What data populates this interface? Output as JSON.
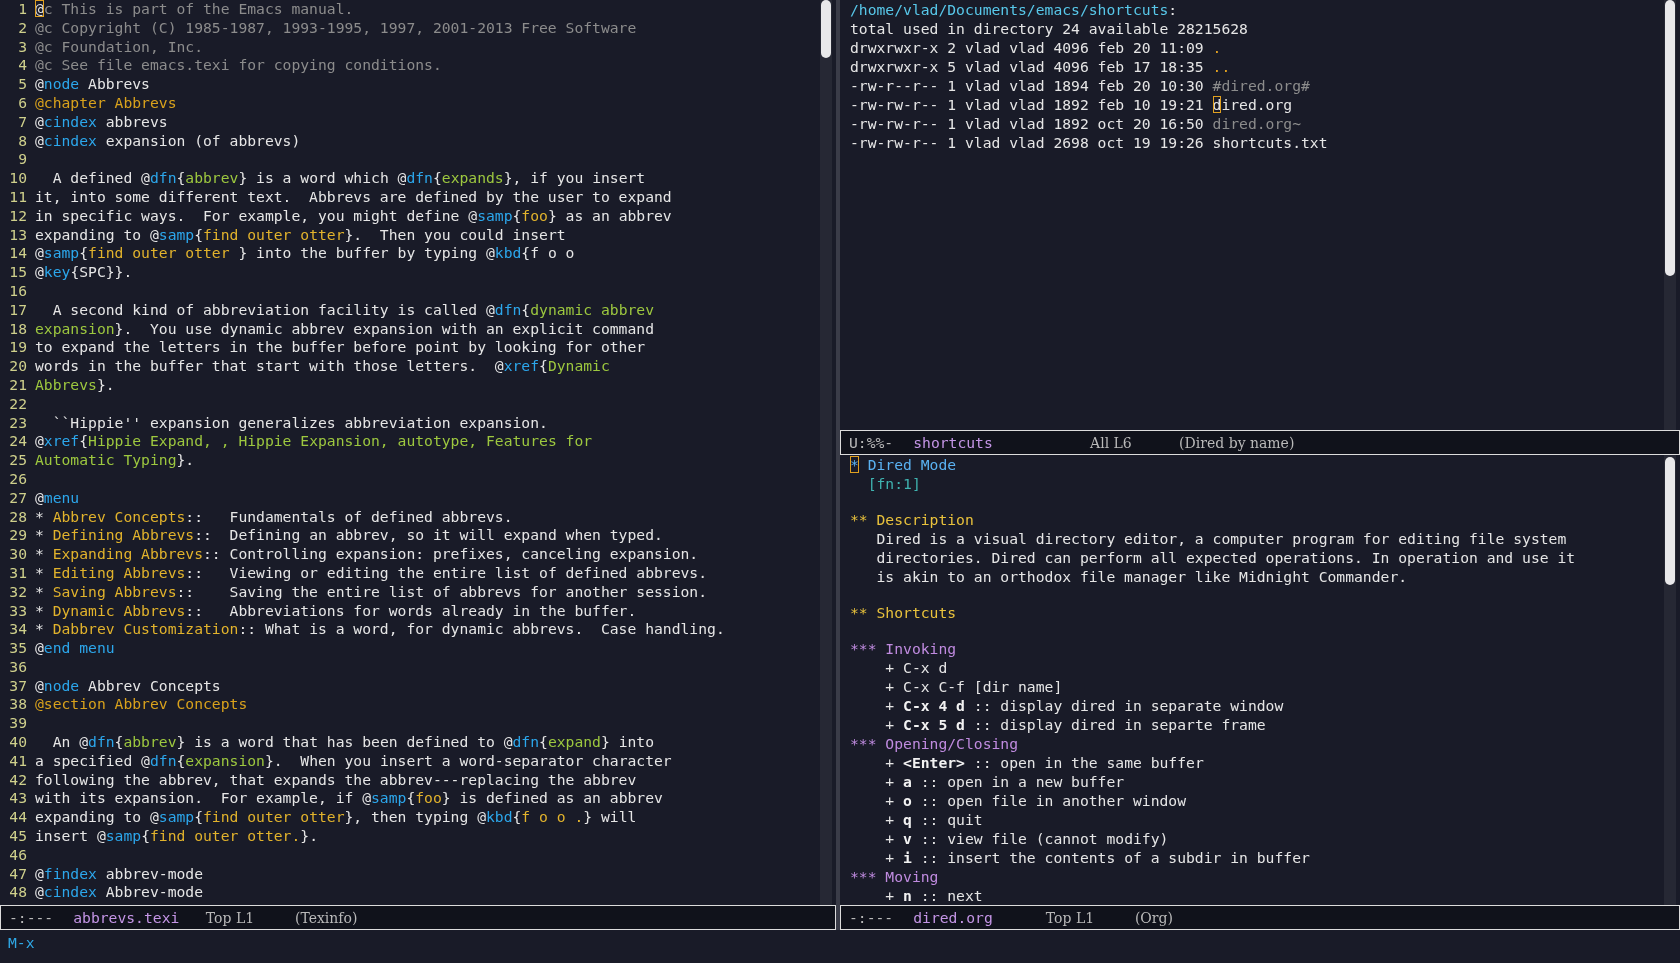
{
  "left_window": {
    "lines": [
      {
        "number": "1",
        "segments": [
          {
            "kind": "cursor",
            "text": "@"
          },
          {
            "kind": "comment",
            "text": "c This is part of the Emacs manual."
          }
        ]
      },
      {
        "number": "2",
        "segments": [
          {
            "kind": "comment",
            "text": "@c Copyright (C) 1985-1987, 1993-1995, 1997, 2001-2013 Free Software"
          }
        ]
      },
      {
        "number": "3",
        "segments": [
          {
            "kind": "comment",
            "text": "@c Foundation, Inc."
          }
        ]
      },
      {
        "number": "4",
        "segments": [
          {
            "kind": "comment",
            "text": "@c See file emacs.texi for copying conditions."
          }
        ]
      },
      {
        "number": "5",
        "segments": [
          {
            "kind": "plain",
            "text": "@"
          },
          {
            "kind": "command",
            "text": "node"
          },
          {
            "kind": "plain",
            "text": " Abbrevs"
          }
        ]
      },
      {
        "number": "6",
        "segments": [
          {
            "kind": "heading",
            "text": "@chapter Abbrevs"
          }
        ]
      },
      {
        "number": "7",
        "segments": [
          {
            "kind": "plain",
            "text": "@"
          },
          {
            "kind": "command",
            "text": "cindex"
          },
          {
            "kind": "plain",
            "text": " abbrevs"
          }
        ]
      },
      {
        "number": "8",
        "segments": [
          {
            "kind": "plain",
            "text": "@"
          },
          {
            "kind": "command",
            "text": "cindex"
          },
          {
            "kind": "plain",
            "text": " expansion (of abbrevs)"
          }
        ]
      },
      {
        "number": "9"
      },
      {
        "number": "10",
        "segments": [
          {
            "kind": "plain",
            "text": "  A defined @"
          },
          {
            "kind": "command",
            "text": "dfn"
          },
          {
            "kind": "plain",
            "text": "{"
          },
          {
            "kind": "argument",
            "text": "abbrev"
          },
          {
            "kind": "plain",
            "text": "} is a word which @"
          },
          {
            "kind": "command",
            "text": "dfn"
          },
          {
            "kind": "plain",
            "text": "{"
          },
          {
            "kind": "argument",
            "text": "expands"
          },
          {
            "kind": "plain",
            "text": "}, if you insert"
          }
        ]
      },
      {
        "number": "11",
        "segments": [
          {
            "kind": "plain",
            "text": "it, into some different text.  Abbrevs are defined by the user to expand"
          }
        ]
      },
      {
        "number": "12",
        "segments": [
          {
            "kind": "plain",
            "text": "in specific ways.  For example, you might define @"
          },
          {
            "kind": "command",
            "text": "samp"
          },
          {
            "kind": "plain",
            "text": "{"
          },
          {
            "kind": "string",
            "text": "foo"
          },
          {
            "kind": "plain",
            "text": "} as an abbrev"
          }
        ]
      },
      {
        "number": "13",
        "segments": [
          {
            "kind": "plain",
            "text": "expanding to @"
          },
          {
            "kind": "command",
            "text": "samp"
          },
          {
            "kind": "plain",
            "text": "{"
          },
          {
            "kind": "string",
            "text": "find outer otter"
          },
          {
            "kind": "plain",
            "text": "}.  Then you could insert"
          }
        ]
      },
      {
        "number": "14",
        "segments": [
          {
            "kind": "plain",
            "text": "@"
          },
          {
            "kind": "command",
            "text": "samp"
          },
          {
            "kind": "plain",
            "text": "{"
          },
          {
            "kind": "string",
            "text": "find outer otter "
          },
          {
            "kind": "plain",
            "text": "} into the buffer by typing @"
          },
          {
            "kind": "command",
            "text": "kbd"
          },
          {
            "kind": "plain",
            "text": "{f o o"
          }
        ]
      },
      {
        "number": "15",
        "segments": [
          {
            "kind": "plain",
            "text": "@"
          },
          {
            "kind": "command",
            "text": "key"
          },
          {
            "kind": "plain",
            "text": "{SPC}}."
          }
        ]
      },
      {
        "number": "16"
      },
      {
        "number": "17",
        "segments": [
          {
            "kind": "plain",
            "text": "  A second kind of abbreviation facility is called @"
          },
          {
            "kind": "command",
            "text": "dfn"
          },
          {
            "kind": "plain",
            "text": "{"
          },
          {
            "kind": "argument",
            "text": "dynamic abbrev"
          }
        ]
      },
      {
        "number": "18",
        "segments": [
          {
            "kind": "argument",
            "text": "expansion"
          },
          {
            "kind": "plain",
            "text": "}.  You use dynamic abbrev expansion with an explicit command"
          }
        ]
      },
      {
        "number": "19",
        "segments": [
          {
            "kind": "plain",
            "text": "to expand the letters in the buffer before point by looking for other"
          }
        ]
      },
      {
        "number": "20",
        "segments": [
          {
            "kind": "plain",
            "text": "words in the buffer that start with those letters.  @"
          },
          {
            "kind": "command",
            "text": "xref"
          },
          {
            "kind": "plain",
            "text": "{"
          },
          {
            "kind": "argument",
            "text": "Dynamic"
          }
        ]
      },
      {
        "number": "21",
        "segments": [
          {
            "kind": "argument",
            "text": "Abbrevs"
          },
          {
            "kind": "plain",
            "text": "}."
          }
        ]
      },
      {
        "number": "22"
      },
      {
        "number": "23",
        "segments": [
          {
            "kind": "plain",
            "text": "  ``Hippie'' expansion generalizes abbreviation expansion."
          }
        ]
      },
      {
        "number": "24",
        "segments": [
          {
            "kind": "plain",
            "text": "@"
          },
          {
            "kind": "command",
            "text": "xref"
          },
          {
            "kind": "plain",
            "text": "{"
          },
          {
            "kind": "argument",
            "text": "Hippie Expand, , Hippie Expansion, autotype, Features for"
          }
        ]
      },
      {
        "number": "25",
        "segments": [
          {
            "kind": "argument",
            "text": "Automatic Typing"
          },
          {
            "kind": "plain",
            "text": "}."
          }
        ]
      },
      {
        "number": "26"
      },
      {
        "number": "27",
        "segments": [
          {
            "kind": "plain",
            "text": "@"
          },
          {
            "kind": "command",
            "text": "menu"
          }
        ]
      },
      {
        "number": "28",
        "segments": [
          {
            "kind": "plain",
            "text": "* "
          },
          {
            "kind": "string",
            "text": "Abbrev Concepts"
          },
          {
            "kind": "plain",
            "text": "::   Fundamentals of defined abbrevs."
          }
        ]
      },
      {
        "number": "29",
        "segments": [
          {
            "kind": "plain",
            "text": "* "
          },
          {
            "kind": "string",
            "text": "Defining Abbrevs"
          },
          {
            "kind": "plain",
            "text": "::  Defining an abbrev, so it will expand when typed."
          }
        ]
      },
      {
        "number": "30",
        "segments": [
          {
            "kind": "plain",
            "text": "* "
          },
          {
            "kind": "string",
            "text": "Expanding Abbrevs"
          },
          {
            "kind": "plain",
            "text": ":: Controlling expansion: prefixes, canceling expansion."
          }
        ]
      },
      {
        "number": "31",
        "segments": [
          {
            "kind": "plain",
            "text": "* "
          },
          {
            "kind": "string",
            "text": "Editing Abbrevs"
          },
          {
            "kind": "plain",
            "text": "::   Viewing or editing the entire list of defined abbrevs."
          }
        ]
      },
      {
        "number": "32",
        "segments": [
          {
            "kind": "plain",
            "text": "* "
          },
          {
            "kind": "string",
            "text": "Saving Abbrevs"
          },
          {
            "kind": "plain",
            "text": "::    Saving the entire list of abbrevs for another session."
          }
        ]
      },
      {
        "number": "33",
        "segments": [
          {
            "kind": "plain",
            "text": "* "
          },
          {
            "kind": "string",
            "text": "Dynamic Abbrevs"
          },
          {
            "kind": "plain",
            "text": "::   Abbreviations for words already in the buffer."
          }
        ]
      },
      {
        "number": "34",
        "segments": [
          {
            "kind": "plain",
            "text": "* "
          },
          {
            "kind": "string",
            "text": "Dabbrev Customization"
          },
          {
            "kind": "plain",
            "text": ":: What is a word, for dynamic abbrevs.  Case handling."
          }
        ]
      },
      {
        "number": "35",
        "segments": [
          {
            "kind": "plain",
            "text": "@"
          },
          {
            "kind": "command",
            "text": "end menu"
          }
        ]
      },
      {
        "number": "36"
      },
      {
        "number": "37",
        "segments": [
          {
            "kind": "plain",
            "text": "@"
          },
          {
            "kind": "command",
            "text": "node"
          },
          {
            "kind": "plain",
            "text": " Abbrev Concepts"
          }
        ]
      },
      {
        "number": "38",
        "segments": [
          {
            "kind": "heading",
            "text": "@section Abbrev Concepts"
          }
        ]
      },
      {
        "number": "39"
      },
      {
        "number": "40",
        "segments": [
          {
            "kind": "plain",
            "text": "  An @"
          },
          {
            "kind": "command",
            "text": "dfn"
          },
          {
            "kind": "plain",
            "text": "{"
          },
          {
            "kind": "argument",
            "text": "abbrev"
          },
          {
            "kind": "plain",
            "text": "} is a word that has been defined to @"
          },
          {
            "kind": "command",
            "text": "dfn"
          },
          {
            "kind": "plain",
            "text": "{"
          },
          {
            "kind": "argument",
            "text": "expand"
          },
          {
            "kind": "plain",
            "text": "} into"
          }
        ]
      },
      {
        "number": "41",
        "segments": [
          {
            "kind": "plain",
            "text": "a specified @"
          },
          {
            "kind": "command",
            "text": "dfn"
          },
          {
            "kind": "plain",
            "text": "{"
          },
          {
            "kind": "argument",
            "text": "expansion"
          },
          {
            "kind": "plain",
            "text": "}.  When you insert a word-separator character"
          }
        ]
      },
      {
        "number": "42",
        "segments": [
          {
            "kind": "plain",
            "text": "following the abbrev, that expands the abbrev---replacing the abbrev"
          }
        ]
      },
      {
        "number": "43",
        "segments": [
          {
            "kind": "plain",
            "text": "with its expansion.  For example, if @"
          },
          {
            "kind": "command",
            "text": "samp"
          },
          {
            "kind": "plain",
            "text": "{"
          },
          {
            "kind": "string",
            "text": "foo"
          },
          {
            "kind": "plain",
            "text": "} is defined as an abbrev"
          }
        ]
      },
      {
        "number": "44",
        "segments": [
          {
            "kind": "plain",
            "text": "expanding to @"
          },
          {
            "kind": "command",
            "text": "samp"
          },
          {
            "kind": "plain",
            "text": "{"
          },
          {
            "kind": "string",
            "text": "find outer otter"
          },
          {
            "kind": "plain",
            "text": "}, then typing @"
          },
          {
            "kind": "command",
            "text": "kbd"
          },
          {
            "kind": "plain",
            "text": "{"
          },
          {
            "kind": "string",
            "text": "f o o ."
          },
          {
            "kind": "plain",
            "text": "} will"
          }
        ]
      },
      {
        "number": "45",
        "segments": [
          {
            "kind": "plain",
            "text": "insert @"
          },
          {
            "kind": "command",
            "text": "samp"
          },
          {
            "kind": "plain",
            "text": "{"
          },
          {
            "kind": "string",
            "text": "find outer otter."
          },
          {
            "kind": "plain",
            "text": "}."
          }
        ]
      },
      {
        "number": "46"
      },
      {
        "number": "47",
        "segments": [
          {
            "kind": "plain",
            "text": "@"
          },
          {
            "kind": "command",
            "text": "findex"
          },
          {
            "kind": "plain",
            "text": " abbrev-mode"
          }
        ]
      },
      {
        "number": "48",
        "segments": [
          {
            "kind": "plain",
            "text": "@"
          },
          {
            "kind": "command",
            "text": "cindex"
          },
          {
            "kind": "plain",
            "text": " Abbrev-mode"
          }
        ]
      }
    ],
    "mode_line": {
      "status": "-:---",
      "buffer": "abbrevs.texi",
      "position": "Top L1",
      "mode": "(Texinfo)"
    }
  },
  "dired_window": {
    "lines": [
      {
        "kind": "text",
        "segments": [
          {
            "kind": "path",
            "text": "/home/vlad/Documents/emacs/shortcuts"
          },
          {
            "kind": "plain",
            "text": ":"
          }
        ]
      },
      {
        "kind": "text",
        "segments": [
          {
            "kind": "plain",
            "text": "total used in directory 24 available 28215628"
          }
        ]
      },
      {
        "kind": "text",
        "segments": [
          {
            "kind": "plain",
            "text": "drwxrwxr-x 2 vlad vlad 4096 feb 20 11:09 "
          },
          {
            "kind": "directory",
            "text": "."
          }
        ]
      },
      {
        "kind": "text",
        "segments": [
          {
            "kind": "plain",
            "text": "drwxrwxr-x 5 vlad vlad 4096 feb 17 18:35 "
          },
          {
            "kind": "directory",
            "text": ".."
          }
        ]
      },
      {
        "kind": "text",
        "segments": [
          {
            "kind": "plain",
            "text": "-rw-r--r-- 1 vlad vlad 1894 feb 20 10:30 "
          },
          {
            "kind": "backup",
            "text": "#dired.org#"
          }
        ]
      },
      {
        "kind": "text",
        "segments": [
          {
            "kind": "plain",
            "text": "-rw-rw-r-- 1 vlad vlad 1892 feb 10 19:21 "
          },
          {
            "kind": "cursor",
            "text": "d"
          },
          {
            "kind": "plain",
            "text": "ired.org"
          }
        ]
      },
      {
        "kind": "text",
        "segments": [
          {
            "kind": "plain",
            "text": "-rw-rw-r-- 1 vlad vlad 1892 oct 20 16:50 "
          },
          {
            "kind": "backup",
            "text": "dired.org~"
          }
        ]
      },
      {
        "kind": "text",
        "segments": [
          {
            "kind": "plain",
            "text": "-rw-rw-r-- 1 vlad vlad 2698 oct 19 19:26 shortcuts.txt"
          }
        ]
      }
    ],
    "mode_line": {
      "status": "U:%%-",
      "buffer": "shortcuts",
      "position": "All L6",
      "mode": "(Dired by name)"
    }
  },
  "org_window": {
    "lines": [
      {
        "kind": "text",
        "segments": [
          {
            "kind": "hollow_cursor",
            "text": "*"
          },
          {
            "kind": "title",
            "text": " Dired Mode"
          }
        ]
      },
      {
        "kind": "text",
        "segments": [
          {
            "kind": "footnote",
            "text": "  [fn:1]"
          }
        ]
      },
      {
        "kind": "blank"
      },
      {
        "kind": "text",
        "segments": [
          {
            "kind": "section",
            "text": "** Description"
          }
        ]
      },
      {
        "kind": "text",
        "segments": [
          {
            "kind": "plain",
            "text": "   Dired is a visual directory editor, a computer program for editing file system"
          }
        ]
      },
      {
        "kind": "text",
        "segments": [
          {
            "kind": "plain",
            "text": "   directories. Dired can perform all expected operations. In operation and use it"
          }
        ]
      },
      {
        "kind": "text",
        "segments": [
          {
            "kind": "plain",
            "text": "   is akin to an orthodox file manager like Midnight Commander."
          }
        ]
      },
      {
        "kind": "blank"
      },
      {
        "kind": "text",
        "segments": [
          {
            "kind": "section",
            "text": "** Shortcuts"
          }
        ]
      },
      {
        "kind": "blank"
      },
      {
        "kind": "text",
        "segments": [
          {
            "kind": "subsection",
            "text": "*** Invoking"
          }
        ]
      },
      {
        "kind": "text",
        "segments": [
          {
            "kind": "plain",
            "text": "    + C-x d"
          }
        ]
      },
      {
        "kind": "text",
        "segments": [
          {
            "kind": "plain",
            "text": "    + C-x C-f [dir name]"
          }
        ]
      },
      {
        "kind": "text",
        "segments": [
          {
            "kind": "plain",
            "text": "    + "
          },
          {
            "kind": "bold",
            "text": "C-x 4 d"
          },
          {
            "kind": "plain",
            "text": " :: display dired in separate window"
          }
        ]
      },
      {
        "kind": "text",
        "segments": [
          {
            "kind": "plain",
            "text": "    + "
          },
          {
            "kind": "bold",
            "text": "C-x 5 d"
          },
          {
            "kind": "plain",
            "text": " :: display dired in separte frame"
          }
        ]
      },
      {
        "kind": "text",
        "segments": [
          {
            "kind": "subsection",
            "text": "*** Opening/Closing"
          }
        ]
      },
      {
        "kind": "text",
        "segments": [
          {
            "kind": "plain",
            "text": "    + "
          },
          {
            "kind": "bold",
            "text": "<Enter>"
          },
          {
            "kind": "plain",
            "text": " :: open in the same buffer"
          }
        ]
      },
      {
        "kind": "text",
        "segments": [
          {
            "kind": "plain",
            "text": "    + "
          },
          {
            "kind": "bold",
            "text": "a"
          },
          {
            "kind": "plain",
            "text": " :: open in a new buffer"
          }
        ]
      },
      {
        "kind": "text",
        "segments": [
          {
            "kind": "plain",
            "text": "    + "
          },
          {
            "kind": "bold",
            "text": "o"
          },
          {
            "kind": "plain",
            "text": " :: open file in another window"
          }
        ]
      },
      {
        "kind": "text",
        "segments": [
          {
            "kind": "plain",
            "text": "    + "
          },
          {
            "kind": "bold",
            "text": "q"
          },
          {
            "kind": "plain",
            "text": " :: quit"
          }
        ]
      },
      {
        "kind": "text",
        "segments": [
          {
            "kind": "plain",
            "text": "    + "
          },
          {
            "kind": "bold",
            "text": "v"
          },
          {
            "kind": "plain",
            "text": " :: view file (cannot modify)"
          }
        ]
      },
      {
        "kind": "text",
        "segments": [
          {
            "kind": "plain",
            "text": "    + "
          },
          {
            "kind": "bold",
            "text": "i"
          },
          {
            "kind": "plain",
            "text": " :: insert the contents of a subdir in buffer"
          }
        ]
      },
      {
        "kind": "text",
        "segments": [
          {
            "kind": "subsection",
            "text": "*** Moving"
          }
        ]
      },
      {
        "kind": "text",
        "segments": [
          {
            "kind": "plain",
            "text": "    + "
          },
          {
            "kind": "bold",
            "text": "n"
          },
          {
            "kind": "plain",
            "text": " :: next"
          }
        ]
      }
    ],
    "mode_line": {
      "status": "-:---",
      "buffer": "dired.org",
      "position": "Top L1",
      "mode": "(Org)"
    }
  },
  "minibuffer": {
    "prompt": "M-x"
  }
}
